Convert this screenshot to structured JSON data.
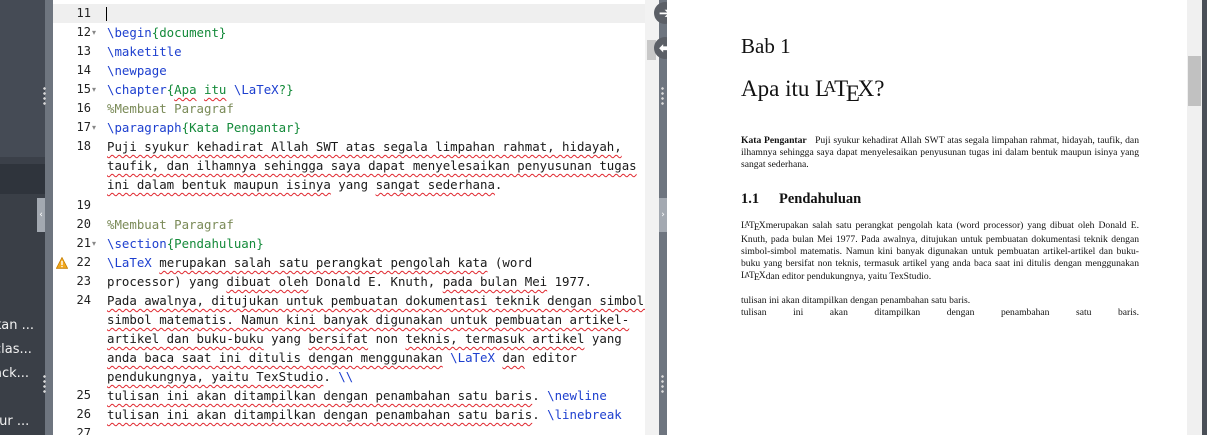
{
  "sidebar": {
    "items": [
      {
        "label": "kan ..."
      },
      {
        "label": "clas..."
      },
      {
        "label": "ack..."
      },
      {
        "label": "tur ..."
      }
    ]
  },
  "editor": {
    "lines": [
      {
        "num": "11",
        "fold": false,
        "current": true
      },
      {
        "num": "12",
        "fold": true
      },
      {
        "num": "13",
        "fold": false
      },
      {
        "num": "14",
        "fold": false
      },
      {
        "num": "15",
        "fold": true
      },
      {
        "num": "16",
        "fold": false
      },
      {
        "num": "17",
        "fold": true
      },
      {
        "num": "18",
        "fold": false
      },
      {
        "num": "19",
        "fold": false
      },
      {
        "num": "20",
        "fold": false
      },
      {
        "num": "21",
        "fold": true
      },
      {
        "num": "22",
        "fold": false,
        "warning": true
      },
      {
        "num": "23",
        "fold": false
      },
      {
        "num": "24",
        "fold": false
      },
      {
        "num": "25",
        "fold": false
      },
      {
        "num": "26",
        "fold": false
      },
      {
        "num": "27",
        "fold": false
      }
    ],
    "code": {
      "l12_cmd": "\\begin",
      "l12_arg": "{document}",
      "l13": "\\maketitle",
      "l14": "\\newpage",
      "l15_cmd": "\\chapter",
      "l15_a": "{",
      "l15_b": "Apa",
      "l15_c": " ",
      "l15_d": "itu",
      "l15_e": " ",
      "l15_f": "\\LaTeX",
      "l15_g": "?}",
      "l16": "%Membuat Paragraf",
      "l17_cmd": "\\paragraph",
      "l17_arg": "{Kata Pengantar}",
      "l18_1": "Puji syukur kehadirat Allah SWT atas segala limpahan rahmat, hidayah,",
      "l18_2": "taufik, dan ilhamnya sehingga saya dapat menyelesaikan penyusunan tugas",
      "l18_3a": "ini dalam bentuk maupun isinya",
      "l18_3b": " yang ",
      "l18_3c": "sangat sederhana",
      "l18_3d": ".",
      "l20": "%Membuat Paragraf",
      "l21_cmd": "\\section",
      "l21_arg": "{Pendahuluan}",
      "l22_cmd": "\\LaTeX",
      "l22_a": " ",
      "l22_b": "merupakan salah satu perangkat pengolah kata",
      "l22_c": " (word",
      "l22_d": "processor) yang ",
      "l22_e": "dibuat oleh",
      "l22_f": " Donald E. Knuth, ",
      "l22_g": "pada bulan Mei",
      "l22_h": " 1977.",
      "l24_1": "Pada awalnya, ditujukan untuk pembuatan dokumentasi teknik dengan simbol-",
      "l24_2": "simbol matematis. Namun kini banyak digunakan untuk pembuatan artikel-",
      "l24_3a": "artikel dan buku-buku",
      "l24_3b": " yang ",
      "l24_3c": "bersifat",
      "l24_3d": " non ",
      "l24_3e": "teknis, termasuk artikel",
      "l24_3f": " yang",
      "l24_4a": "anda baca saat ini ditulis dengan menggunakan",
      "l24_4b": " ",
      "l24_4c": "\\LaTeX",
      "l24_4d": " ",
      "l24_4e": "dan",
      "l24_4f": " editor",
      "l24_5a": "pendukungnya, yaitu TexStudio",
      "l24_5b": ". ",
      "l24_5c": "\\\\",
      "l25_a": "tulisan ini akan ditampilkan dengan penambahan satu baris",
      "l25_b": ". ",
      "l25_c": "\\newline",
      "l26_a": "tulisan ini akan ditampilkan dengan penambahan satu baris",
      "l26_b": ". ",
      "l26_c": "\\linebreak"
    }
  },
  "sync": {
    "forward_icon": "arrow-right-circle-icon",
    "back_icon": "arrow-left-circle-icon",
    "forward_glyph": "➔",
    "back_glyph": "⬅"
  },
  "preview": {
    "chapter": "Bab 1",
    "title_pre": "Apa itu ",
    "title_post": "?",
    "kp_label": "Kata Pengantar",
    "kp_text": "Puji syukur kehadirat Allah SWT atas segala limpahan rahmat, hidayah, taufik, dan ilhamnya sehingga saya dapat menyelesaikan penyusunan tugas ini dalam bentuk maupun isinya yang sangat sederhana.",
    "section_num": "1.1",
    "section_title": "Pendahuluan",
    "p1_a": "merupakan salah satu perangkat pengolah kata (word processor) yang dibuat oleh Donald E. Knuth, pada bulan Mei 1977. Pada awalnya, ditujukan untuk pembuatan dokumentasi teknik dengan simbol-simbol matematis. Namun kini banyak digunakan untuk pembuatan artikel-artikel dan buku-buku yang bersifat non teknis, termasuk artikel yang anda baca saat ini ditulis dengan menggunakan ",
    "p1_b": "dan editor pendukungnya, yaitu TexStudio.",
    "p2": "tulisan ini akan ditampilkan dengan penambahan satu baris.",
    "p3": "tulisan ini akan ditampilkan dengan penambahan satu baris.",
    "logo": {
      "l": "L",
      "a": "A",
      "t": "T",
      "e": "E",
      "x": "X"
    }
  },
  "colors": {
    "command": "#1d3fcf",
    "argument": "#148a3a",
    "comment": "#7a8a57",
    "spell_error": "#e0262e",
    "sidebar": "#3b4049"
  }
}
